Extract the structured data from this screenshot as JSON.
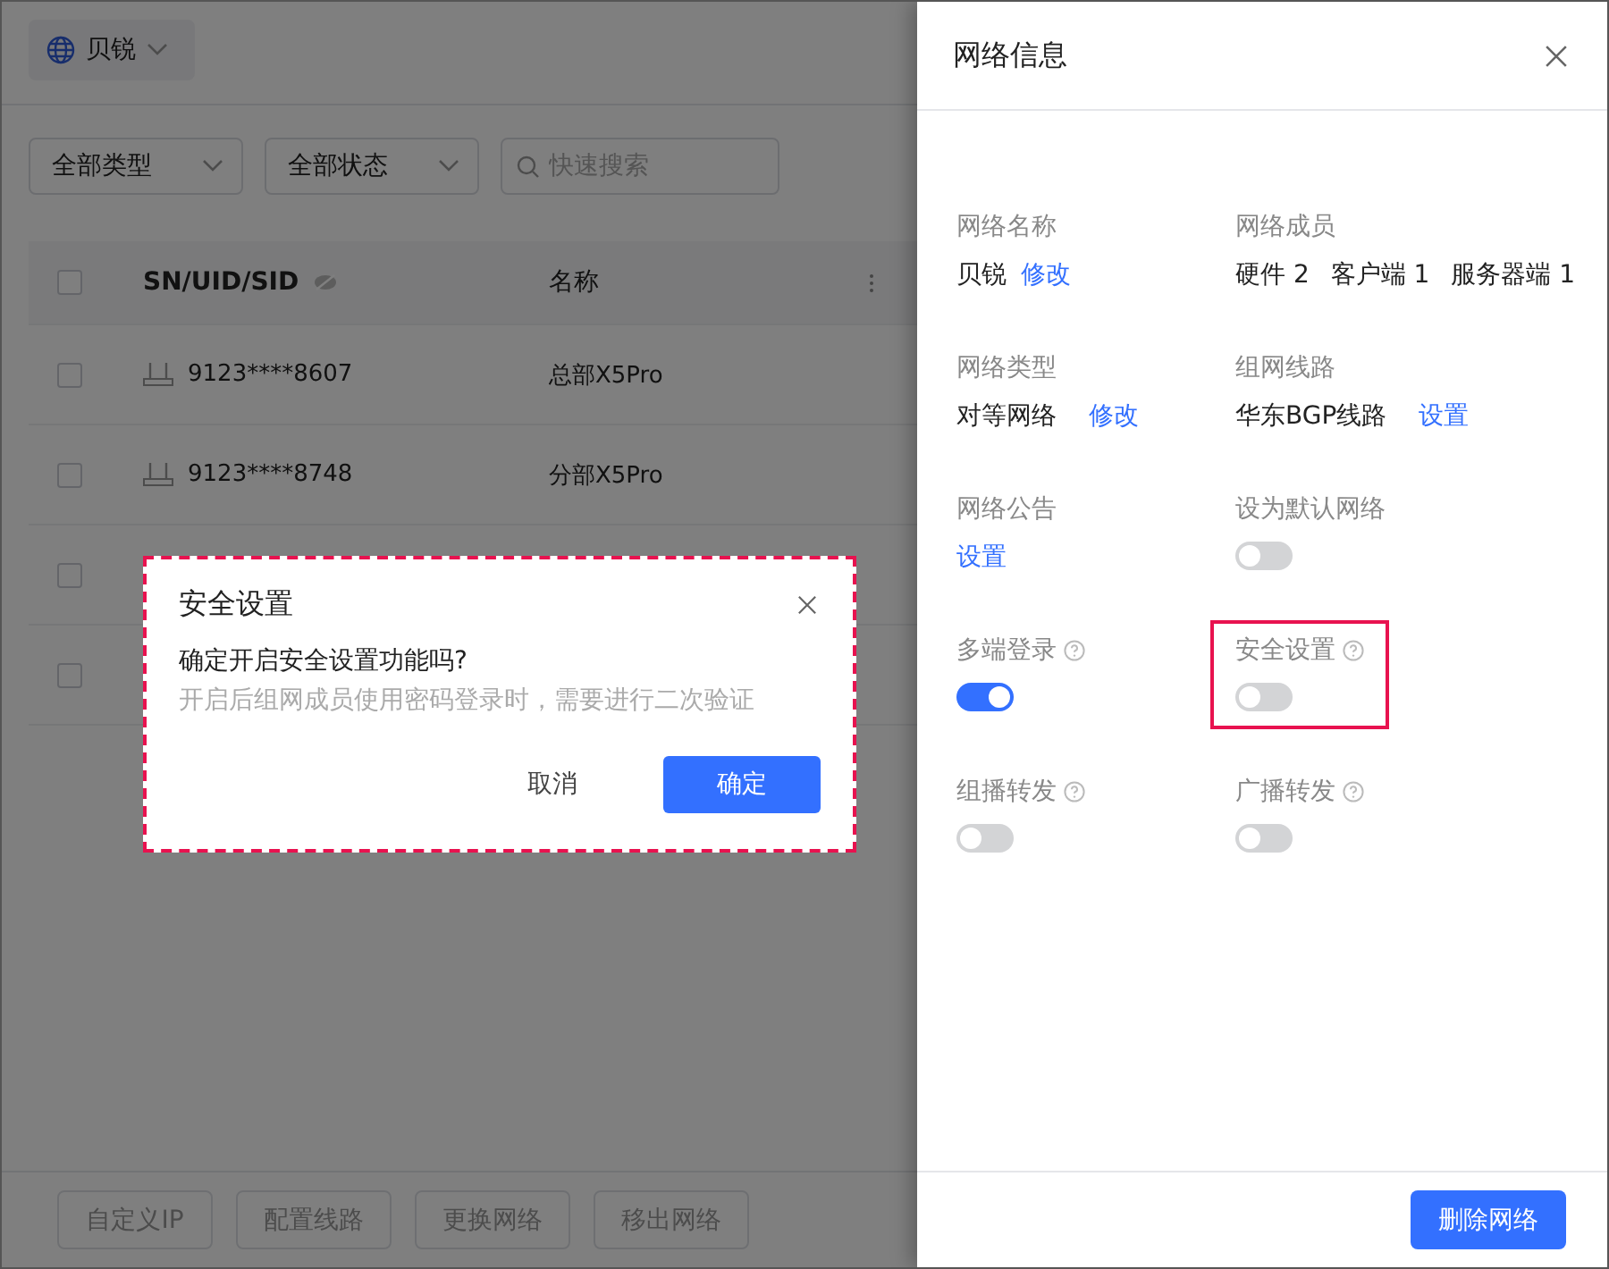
{
  "top_bar": {
    "network_button": {
      "label": "贝锐"
    }
  },
  "filters": [
    {
      "kind": "select",
      "label": "全部类型"
    },
    {
      "kind": "select",
      "label": "全部状态"
    },
    {
      "kind": "search",
      "placeholder": "快速搜索"
    }
  ],
  "table": {
    "header_checked": false,
    "columns": [
      {
        "kind": "sn",
        "label": "SN/UID/SID"
      },
      {
        "kind": "name",
        "label": "名称"
      }
    ],
    "rows": [
      {
        "checked": false,
        "sn": "9123****8607",
        "name": "总部X5Pro"
      },
      {
        "checked": false,
        "sn": "9123****8748",
        "name": "分部X5Pro"
      },
      {
        "checked": false
      },
      {
        "checked": false
      }
    ]
  },
  "bottom_actions": [
    "自定义IP",
    "配置线路",
    "更换网络",
    "移出网络"
  ],
  "drawer": {
    "title": "网络信息",
    "fields": [
      {
        "kind": "value_link",
        "label": "网络名称",
        "value": "贝锐",
        "link": "修改",
        "highlighted": false
      },
      {
        "kind": "counts",
        "label": "网络成员",
        "items": [
          "硬件 2",
          "客户端 1",
          "服务器端 1"
        ],
        "highlighted": false
      },
      {
        "kind": "value_link",
        "label": "网络类型",
        "value": "对等网络",
        "link": "修改",
        "highlighted": false
      },
      {
        "kind": "value_link",
        "label": "组网线路",
        "value": "华东BGP线路",
        "link": "设置",
        "highlighted": false
      },
      {
        "kind": "link",
        "label": "网络公告",
        "link": "设置",
        "highlighted": false
      },
      {
        "kind": "switch",
        "label": "设为默认网络",
        "on": false,
        "help": false,
        "highlighted": false
      },
      {
        "kind": "switch",
        "label": "多端登录",
        "on": true,
        "help": true,
        "highlighted": false
      },
      {
        "kind": "switch",
        "label": "安全设置",
        "on": false,
        "help": true,
        "highlighted": true
      },
      {
        "kind": "switch",
        "label": "组播转发",
        "on": false,
        "help": true,
        "highlighted": false
      },
      {
        "kind": "switch",
        "label": "广播转发",
        "on": false,
        "help": true,
        "highlighted": false
      }
    ],
    "footer_button": "删除网络"
  },
  "dialog": {
    "title": "安全设置",
    "question": "确定开启安全设置功能吗?",
    "description": "开启后组网成员使用密码登录时，需要进行二次验证",
    "highlighted": true,
    "buttons": [
      {
        "kind": "text",
        "label": "取消"
      },
      {
        "kind": "primary",
        "label": "确定"
      }
    ]
  }
}
